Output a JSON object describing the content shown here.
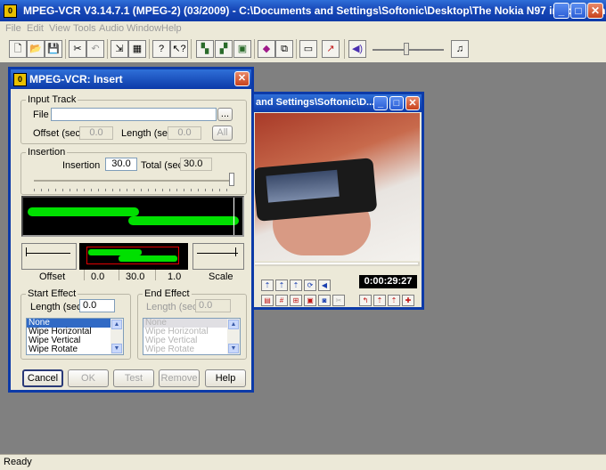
{
  "app": {
    "title": "MPEG-VCR V3.14.7.1 (MPEG-2) (03/2009) - C:\\Documents and Settings\\Softonic\\Desktop\\The Nokia N97 in action.mpg",
    "icon_letter": "0",
    "window_controls": {
      "minimize": "_",
      "maximize": "□",
      "close": "✕"
    }
  },
  "menu": [
    "File",
    "Edit",
    "View",
    "Tools",
    "Audio",
    "Window",
    "Help"
  ],
  "toolbar": {
    "icons": [
      "new-file-icon",
      "open-folder-icon",
      "save-icon",
      "cut-icon",
      "undo-icon",
      "select-icon",
      "grid-icon",
      "help-icon",
      "context-help-icon",
      "split-icon",
      "join-icon",
      "merge-icon",
      "record-icon",
      "export-icon",
      "monitor-icon",
      "jump-icon",
      "speaker-icon",
      "volume-slider",
      "audio-settings-icon"
    ]
  },
  "status": "Ready",
  "dialog": {
    "title": "MPEG-VCR: Insert",
    "input_track": {
      "legend": "Input Track",
      "file_label": "File",
      "file_value": "",
      "browse_label": "...",
      "offset_label": "Offset (sec)",
      "offset_value": "0.0",
      "length_label": "Length (sec)",
      "length_value": "0.0",
      "all_label": "All"
    },
    "insertion": {
      "legend": "Insertion",
      "insertion_label": "Insertion",
      "insertion_value": "30.0",
      "total_label": "Total (sec)",
      "total_value": "30.0"
    },
    "timeline_scale": {
      "offset_caption": "Offset",
      "scale_caption": "Scale",
      "values": [
        "0.0",
        "30.0",
        "1.0"
      ]
    },
    "start_effect": {
      "legend": "Start Effect",
      "length_label": "Length (sec)",
      "length_value": "0.0",
      "options": [
        "None",
        "Wipe Horizontal",
        "Wipe Vertical",
        "Wipe Rotate"
      ],
      "selected": "None"
    },
    "end_effect": {
      "legend": "End Effect",
      "length_label": "Length (sec)",
      "length_value": "0.0",
      "options": [
        "None",
        "Wipe Horizontal",
        "Wipe Vertical",
        "Wipe Rotate"
      ],
      "selected": "None"
    },
    "buttons": {
      "cancel": "Cancel",
      "ok": "OK",
      "test": "Test",
      "remove": "Remove",
      "help": "Help"
    }
  },
  "video_window": {
    "title": "and Settings\\Softonic\\D...",
    "timecode": "0:00:29:27"
  },
  "colors": {
    "titlebar": "#0c3aa8",
    "desktop": "#808080",
    "timeline_bg": "#000000",
    "track_green": "#00e000",
    "marker_red": "#e00000"
  }
}
